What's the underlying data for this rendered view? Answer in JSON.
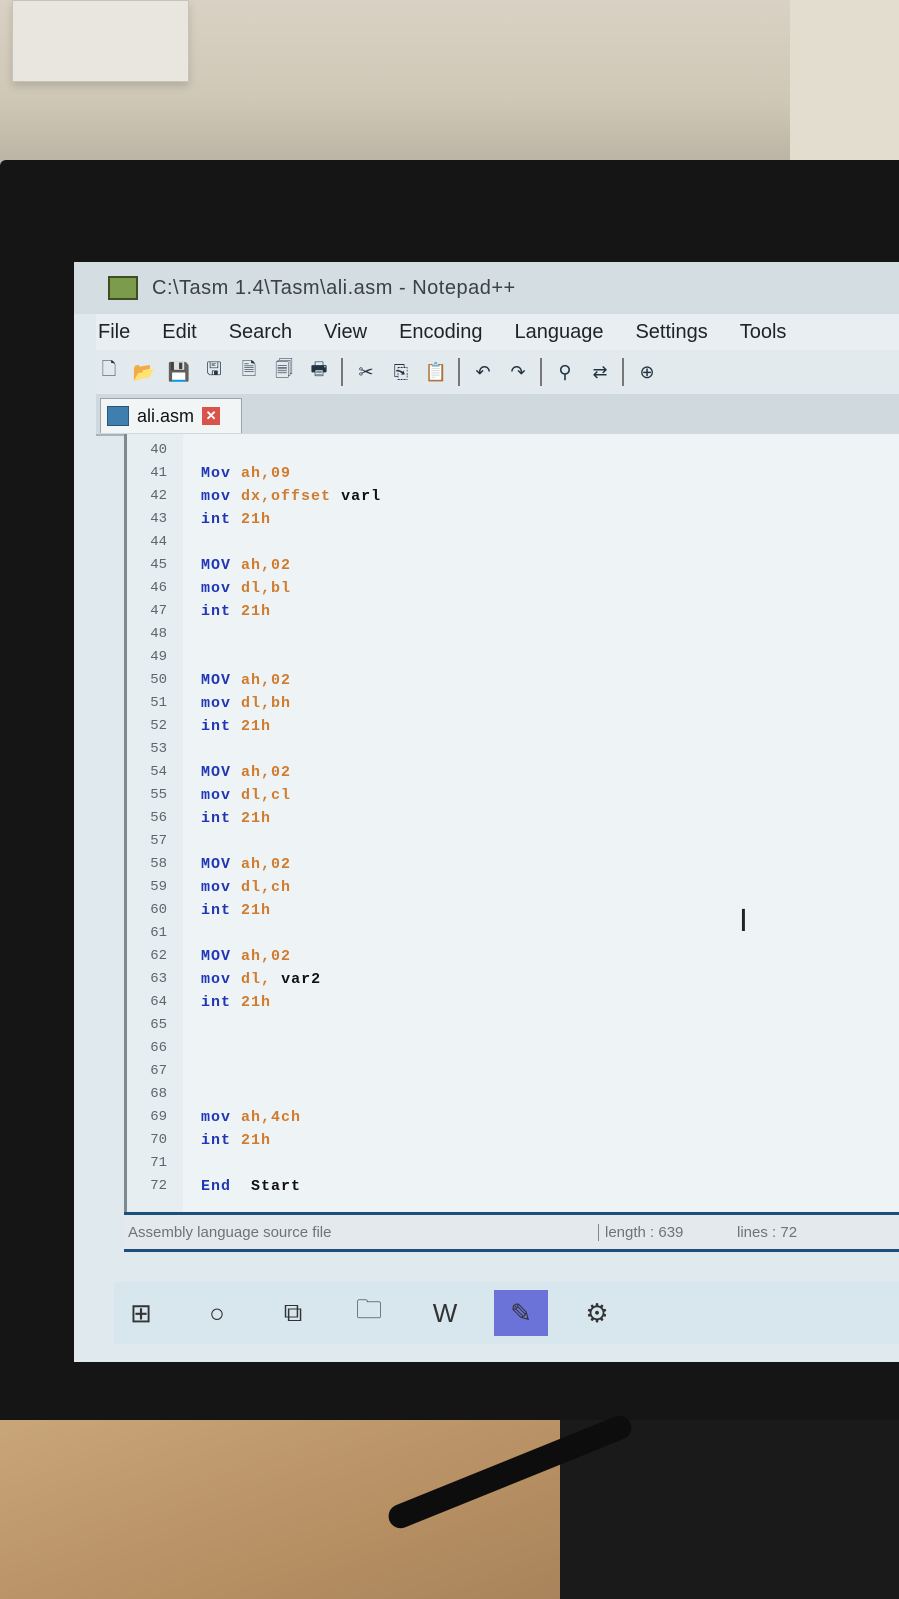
{
  "window": {
    "title": "C:\\Tasm 1.4\\Tasm\\ali.asm - Notepad++"
  },
  "menu": [
    "File",
    "Edit",
    "Search",
    "View",
    "Encoding",
    "Language",
    "Settings",
    "Tools"
  ],
  "toolbar": {
    "icons": [
      "new-icon",
      "open-icon",
      "save-icon",
      "save-all-icon",
      "close-icon",
      "close-all-icon",
      "print-icon",
      "cut-icon",
      "copy-icon",
      "paste-icon",
      "undo-icon",
      "redo-icon",
      "find-icon",
      "replace-icon",
      "zoom-icon"
    ]
  },
  "tab": {
    "label": "ali.asm"
  },
  "editor": {
    "lines": [
      {
        "n": "40",
        "kw": "",
        "op": "",
        "tx": ""
      },
      {
        "n": "41",
        "kw": "Mov",
        "op": "ah,09",
        "tx": ""
      },
      {
        "n": "42",
        "kw": "mov",
        "op": "dx,offset",
        "tx": "varl"
      },
      {
        "n": "43",
        "kw": "int",
        "op": "21h",
        "tx": ""
      },
      {
        "n": "44",
        "kw": "",
        "op": "",
        "tx": ""
      },
      {
        "n": "45",
        "kw": "MOV",
        "op": "ah,02",
        "tx": ""
      },
      {
        "n": "46",
        "kw": "mov",
        "op": "dl,bl",
        "tx": ""
      },
      {
        "n": "47",
        "kw": "int",
        "op": "21h",
        "tx": ""
      },
      {
        "n": "48",
        "kw": "",
        "op": "",
        "tx": ""
      },
      {
        "n": "49",
        "kw": "",
        "op": "",
        "tx": ""
      },
      {
        "n": "50",
        "kw": "MOV",
        "op": "ah,02",
        "tx": ""
      },
      {
        "n": "51",
        "kw": "mov",
        "op": "dl,bh",
        "tx": ""
      },
      {
        "n": "52",
        "kw": "int",
        "op": "21h",
        "tx": ""
      },
      {
        "n": "53",
        "kw": "",
        "op": "",
        "tx": ""
      },
      {
        "n": "54",
        "kw": "MOV",
        "op": "ah,02",
        "tx": ""
      },
      {
        "n": "55",
        "kw": "mov",
        "op": "dl,cl",
        "tx": ""
      },
      {
        "n": "56",
        "kw": "int",
        "op": "21h",
        "tx": ""
      },
      {
        "n": "57",
        "kw": "",
        "op": "",
        "tx": ""
      },
      {
        "n": "58",
        "kw": "MOV",
        "op": "ah,02",
        "tx": ""
      },
      {
        "n": "59",
        "kw": "mov",
        "op": "dl,ch",
        "tx": ""
      },
      {
        "n": "60",
        "kw": "int",
        "op": "21h",
        "tx": ""
      },
      {
        "n": "61",
        "kw": "",
        "op": "",
        "tx": ""
      },
      {
        "n": "62",
        "kw": "MOV",
        "op": "ah,02",
        "tx": ""
      },
      {
        "n": "63",
        "kw": "mov",
        "op": "dl,",
        "tx": "var2"
      },
      {
        "n": "64",
        "kw": "int",
        "op": "21h",
        "tx": ""
      },
      {
        "n": "65",
        "kw": "",
        "op": "",
        "tx": ""
      },
      {
        "n": "66",
        "kw": "",
        "op": "",
        "tx": ""
      },
      {
        "n": "67",
        "kw": "",
        "op": "",
        "tx": ""
      },
      {
        "n": "68",
        "kw": "",
        "op": "",
        "tx": ""
      },
      {
        "n": "69",
        "kw": "mov",
        "op": "ah,4ch",
        "tx": ""
      },
      {
        "n": "70",
        "kw": "int",
        "op": "21h",
        "tx": ""
      },
      {
        "n": "71",
        "kw": "",
        "op": "",
        "tx": ""
      },
      {
        "n": "72",
        "kw": "End",
        "op": "",
        "tx": "Start"
      }
    ]
  },
  "status": {
    "file_type": "Assembly language source file",
    "length": "length : 639",
    "lines": "lines : 72"
  },
  "taskbar": {
    "icons": [
      "windows-start-icon",
      "search-icon",
      "task-view-icon",
      "file-explorer-icon",
      "word-icon",
      "notepadpp-icon",
      "app-icon"
    ]
  },
  "colors": {
    "keyword": "#2036b6",
    "operand": "#d07b2e",
    "status_border": "#1e4f7a",
    "taskbar_active": "#6b73d8"
  }
}
